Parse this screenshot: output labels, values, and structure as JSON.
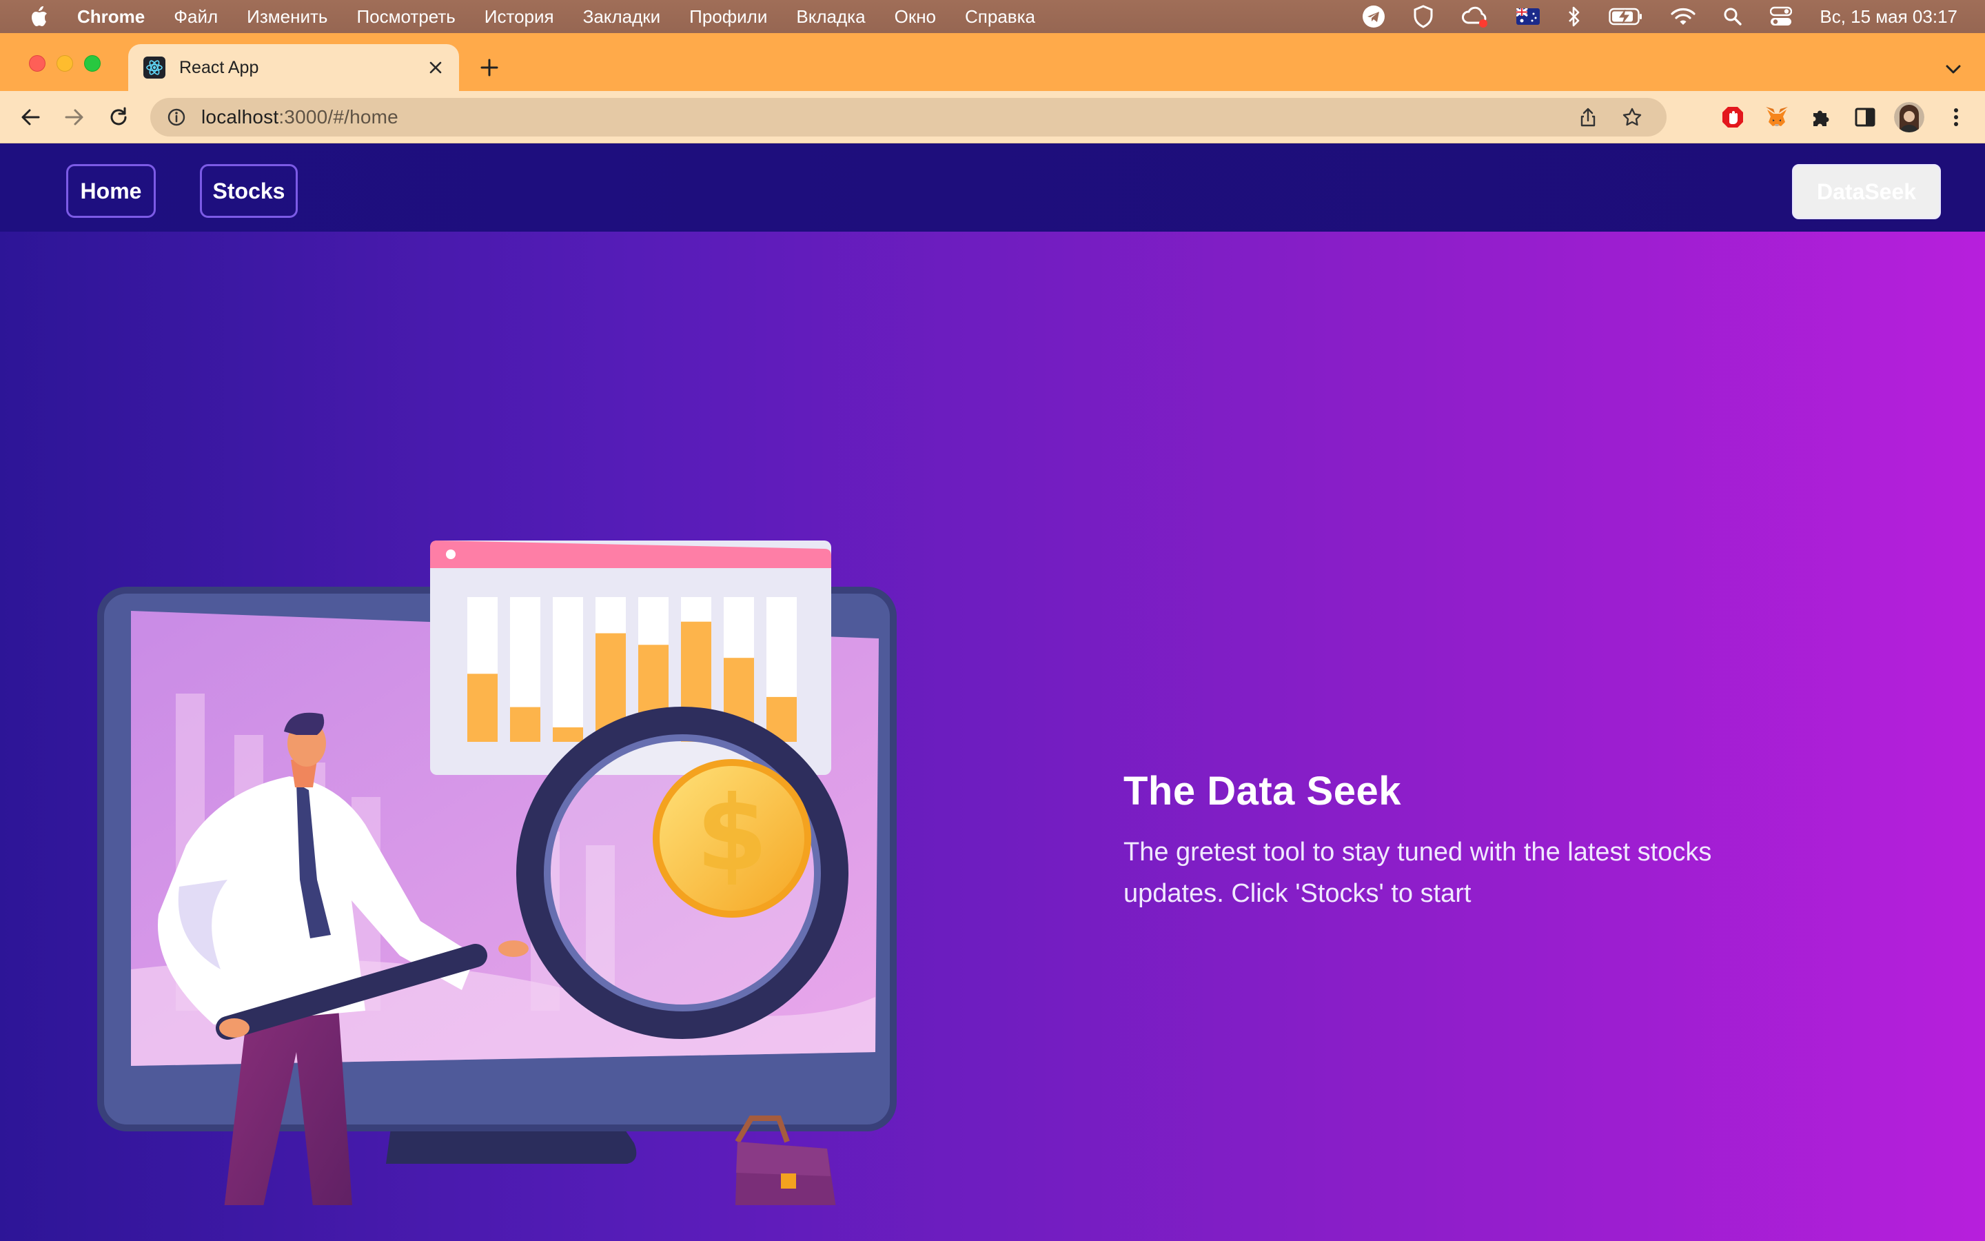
{
  "menubar": {
    "app_name": "Chrome",
    "items": [
      "Файл",
      "Изменить",
      "Посмотреть",
      "История",
      "Закладки",
      "Профили",
      "Вкладка",
      "Окно",
      "Справка"
    ],
    "clock": "Вс, 15 мая  03:17",
    "status_icons": [
      "telegram-icon",
      "shield-icon",
      "creative-cloud-icon",
      "australia-flag-icon",
      "bluetooth-icon",
      "battery-charging-icon",
      "wifi-icon",
      "spotlight-search-icon",
      "control-center-icon"
    ]
  },
  "browser": {
    "tab_title": "React App",
    "url_host": "localhost",
    "url_rest": ":3000/#/home"
  },
  "navbar": {
    "home_label": "Home",
    "stocks_label": "Stocks",
    "brand_label": "DataSeek"
  },
  "hero": {
    "title": "The Data Seek",
    "line1": "The gretest tool to stay tuned with the latest stocks",
    "line2": "updates. Click 'Stocks' to start",
    "illustration_chart_bar_fill_pct": [
      47,
      24,
      10,
      75,
      67,
      83,
      58,
      31
    ]
  },
  "colors": {
    "menubar": "#9b6a55",
    "tabstrip": "#ffaa4a",
    "toolbar": "#fde2bd",
    "navbar": "#1e0f80",
    "gradient_start": "#2d1597",
    "gradient_end": "#b71fdc",
    "nav_button_border": "#7c5be6"
  }
}
